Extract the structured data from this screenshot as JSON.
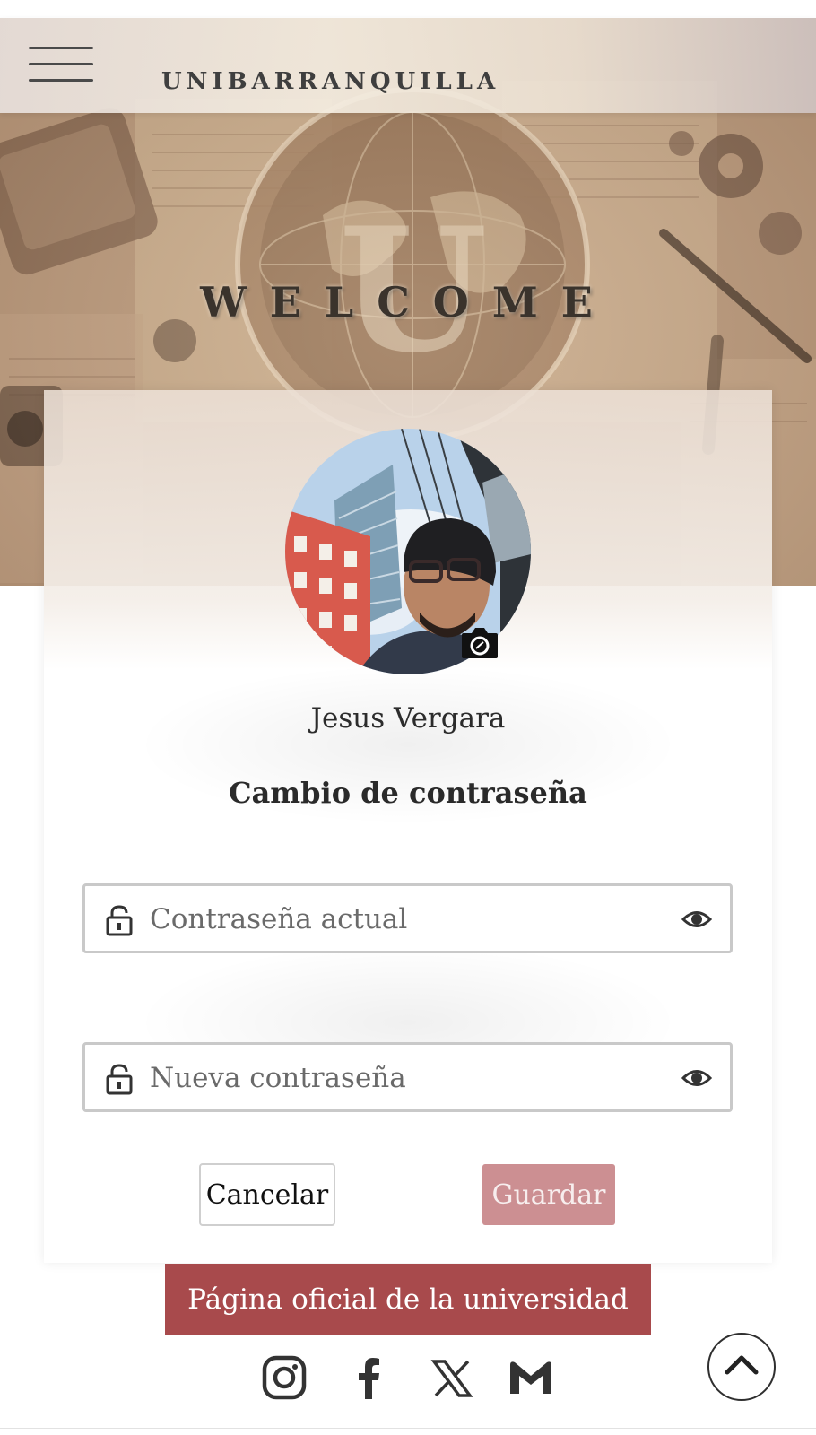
{
  "header": {
    "brand": "UNIBARRANQUILLA",
    "menu_icon": "hamburger-menu-icon"
  },
  "hero": {
    "welcome": "WELCOME"
  },
  "profile": {
    "name": "Jesus Vergara",
    "camera_icon": "camera-icon"
  },
  "form": {
    "title": "Cambio de contraseña",
    "current_password": {
      "placeholder": "Contraseña actual",
      "value": ""
    },
    "new_password": {
      "placeholder": "Nueva contraseña",
      "value": ""
    },
    "cancel_label": "Cancelar",
    "save_label": "Guardar"
  },
  "footer": {
    "official_link": "Página oficial de la universidad",
    "social": [
      "instagram-icon",
      "facebook-icon",
      "x-icon",
      "gmail-icon"
    ],
    "scroll_top_icon": "chevron-up-icon"
  },
  "colors": {
    "primary": "#a84a4c",
    "save_button": "#cc8f92",
    "text": "#2b2b2b"
  }
}
